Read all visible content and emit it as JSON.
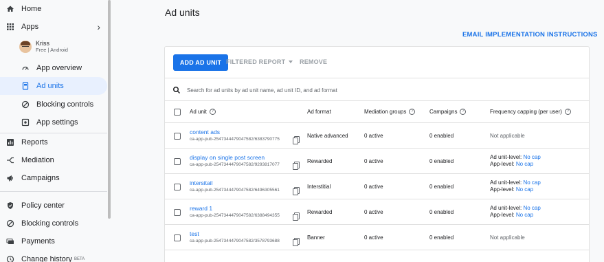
{
  "sidebar": {
    "items": [
      {
        "label": "Home",
        "icon": "home-icon"
      },
      {
        "label": "Apps",
        "icon": "apps-grid-icon"
      },
      {
        "label": "App overview",
        "icon": "gauge-icon"
      },
      {
        "label": "Ad units",
        "icon": "ad-unit-icon"
      },
      {
        "label": "Blocking controls",
        "icon": "block-icon"
      },
      {
        "label": "App settings",
        "icon": "settings-square-icon"
      },
      {
        "label": "Reports",
        "icon": "bar-chart-icon"
      },
      {
        "label": "Mediation",
        "icon": "mediation-icon"
      },
      {
        "label": "Campaigns",
        "icon": "megaphone-icon"
      },
      {
        "label": "Policy center",
        "icon": "shield-icon"
      },
      {
        "label": "Blocking controls",
        "icon": "block-icon"
      },
      {
        "label": "Payments",
        "icon": "payments-icon"
      },
      {
        "label": "Change history",
        "icon": "history-icon",
        "badge": "BETA"
      }
    ],
    "app": {
      "name": "Kriss",
      "subtitle": "Free | Android"
    }
  },
  "page": {
    "title": "Ad units",
    "email_link": "EMAIL IMPLEMENTATION INSTRUCTIONS"
  },
  "toolbar": {
    "add_label": "ADD AD UNIT",
    "filtered_label": "FILTERED REPORT",
    "remove_label": "REMOVE"
  },
  "search": {
    "placeholder": "Search for ad units by ad unit name, ad unit ID, and ad format"
  },
  "table": {
    "columns": [
      "Ad unit",
      "Ad format",
      "Mediation groups",
      "Campaigns",
      "Frequency capping (per user)"
    ],
    "rows": [
      {
        "name": "content ads",
        "id": "ca-app-pub-2547344479047582/6383790775",
        "format": "Native advanced",
        "mediation": "0 active",
        "campaigns": "0 enabled",
        "fc_type": "na",
        "fc_text": "Not applicable"
      },
      {
        "name": "display on single post screen",
        "id": "ca-app-pub-2547344479047582/9293817077",
        "format": "Rewarded",
        "mediation": "0 active",
        "campaigns": "0 enabled",
        "fc_type": "cap",
        "fc_unit_label": "Ad unit-level:",
        "fc_unit_val": "No cap",
        "fc_app_label": "App-level:",
        "fc_app_val": "No cap"
      },
      {
        "name": "intersitail",
        "id": "ca-app-pub-2547344479047582/6496305561",
        "format": "Interstitial",
        "mediation": "0 active",
        "campaigns": "0 enabled",
        "fc_type": "cap",
        "fc_unit_label": "Ad unit-level:",
        "fc_unit_val": "No cap",
        "fc_app_label": "App-level:",
        "fc_app_val": "No cap"
      },
      {
        "name": "reward 1",
        "id": "ca-app-pub-2547344479047582/6388494355",
        "format": "Rewarded",
        "mediation": "0 active",
        "campaigns": "0 enabled",
        "fc_type": "cap",
        "fc_unit_label": "Ad unit-level:",
        "fc_unit_val": "No cap",
        "fc_app_label": "App-level:",
        "fc_app_val": "No cap"
      },
      {
        "name": "test",
        "id": "ca-app-pub-2547344479047582/3578793688",
        "format": "Banner",
        "mediation": "0 active",
        "campaigns": "0 enabled",
        "fc_type": "na",
        "fc_text": "Not applicable"
      }
    ]
  },
  "colors": {
    "accent": "#1a73e8",
    "active_bg": "#e8f0fe",
    "text": "#202124",
    "muted": "#5f6368"
  }
}
